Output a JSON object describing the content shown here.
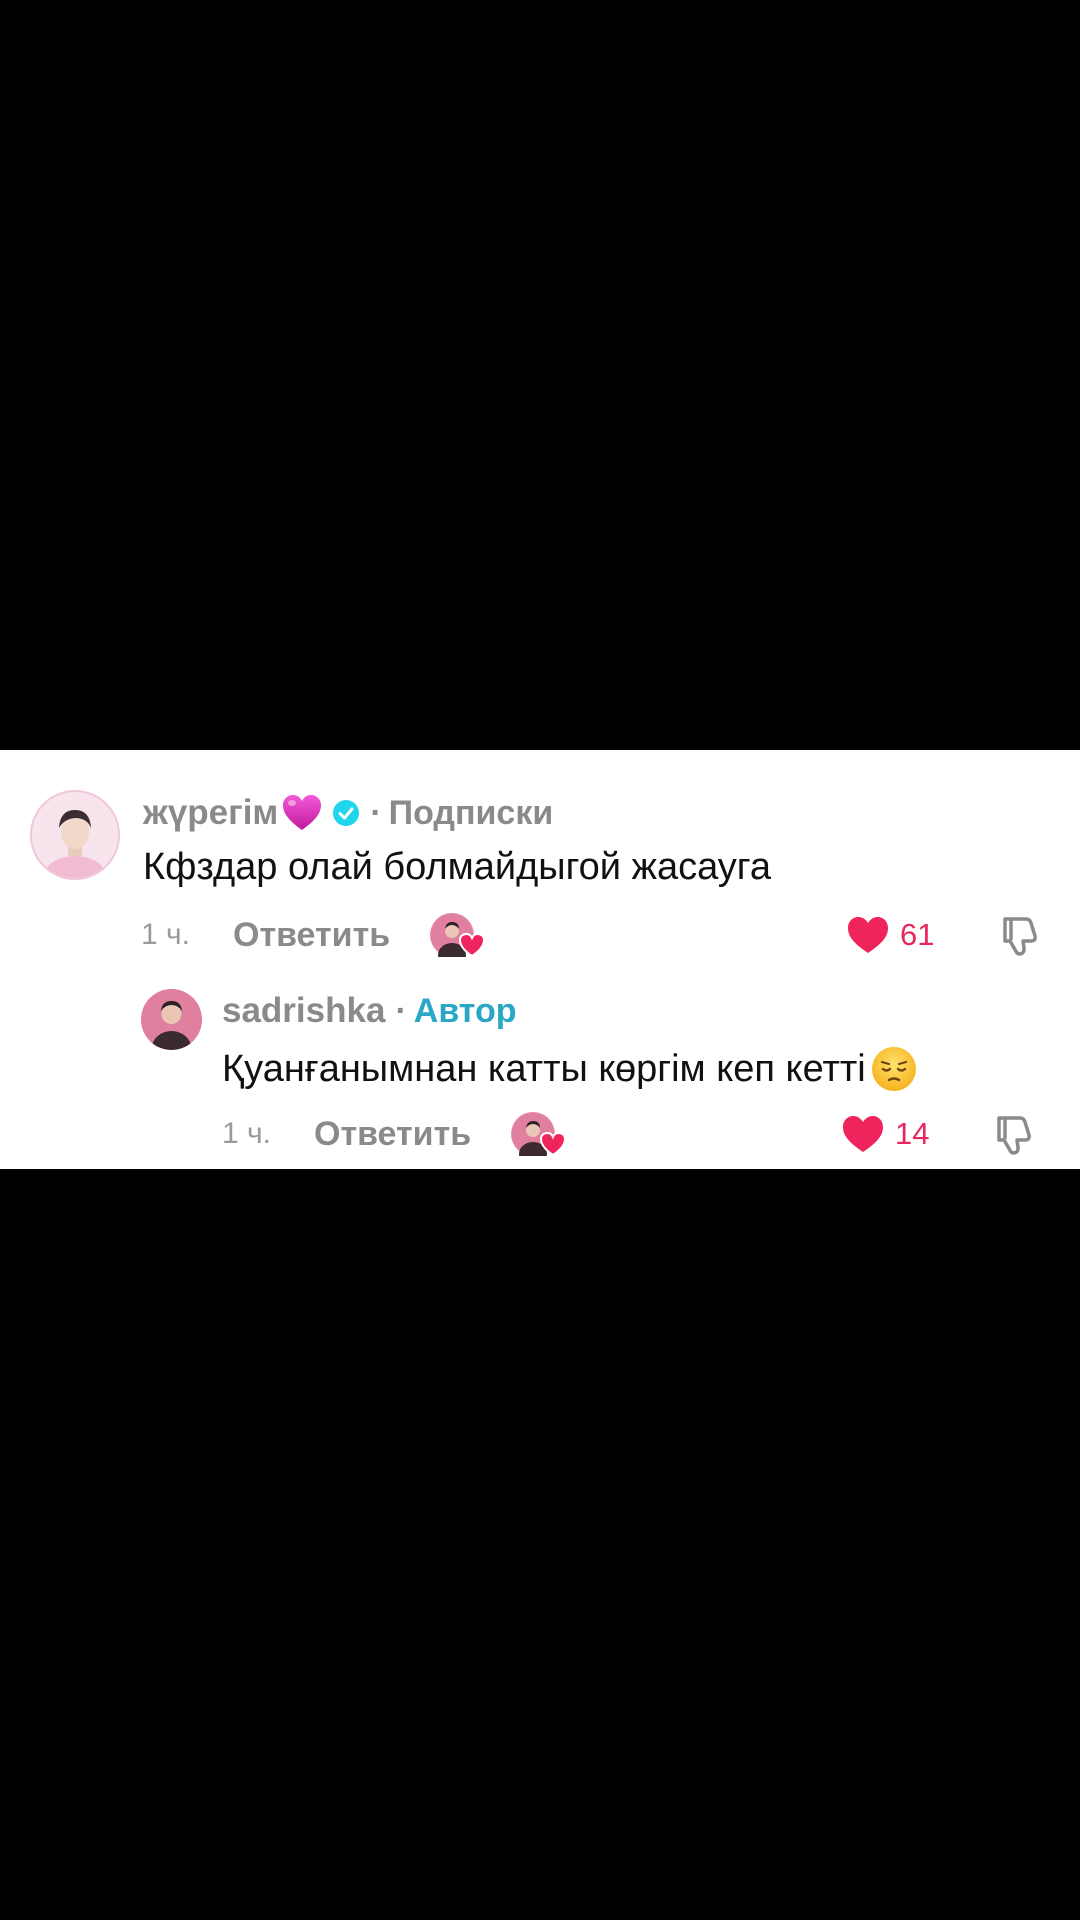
{
  "colors": {
    "background": "#000000",
    "panel": "#ffffff",
    "like": "#e8285e",
    "author_tag": "#2aa6c6",
    "muted": "#8a8a8a",
    "verified": "#20d5ec"
  },
  "comments": [
    {
      "username": "жүрегім",
      "username_emoji": "pink-heart",
      "verified": true,
      "tag": "Подписки",
      "text": "Кфздар олай болмайдыгой жасауга",
      "time": "1 ч.",
      "reply_label": "Ответить",
      "likes": "61",
      "creator_liked": true
    },
    {
      "username": "sadrishka",
      "tag": "Автор",
      "text": "Қуанғанымнан катты көргім кеп кетті",
      "text_emoji": "pensive-face",
      "time": "1 ч.",
      "reply_label": "Ответить",
      "likes": "14",
      "creator_liked": true
    }
  ],
  "separator": "·"
}
